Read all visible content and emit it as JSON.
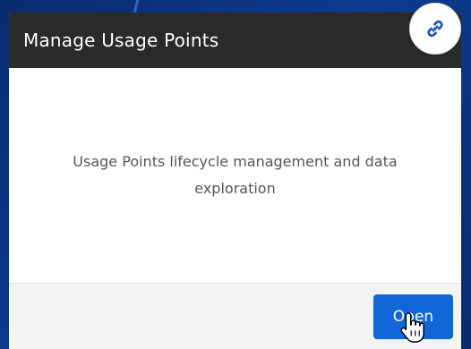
{
  "card": {
    "title": "Manage Usage Points",
    "description": "Usage Points lifecycle management and data exploration",
    "open_label": "Open"
  },
  "icons": {
    "link": "link-icon",
    "cursor": "hand-pointer-icon"
  },
  "colors": {
    "header_bg": "#2a2a2a",
    "button_bg": "#1166d8",
    "page_bg": "#0c3b8f"
  }
}
